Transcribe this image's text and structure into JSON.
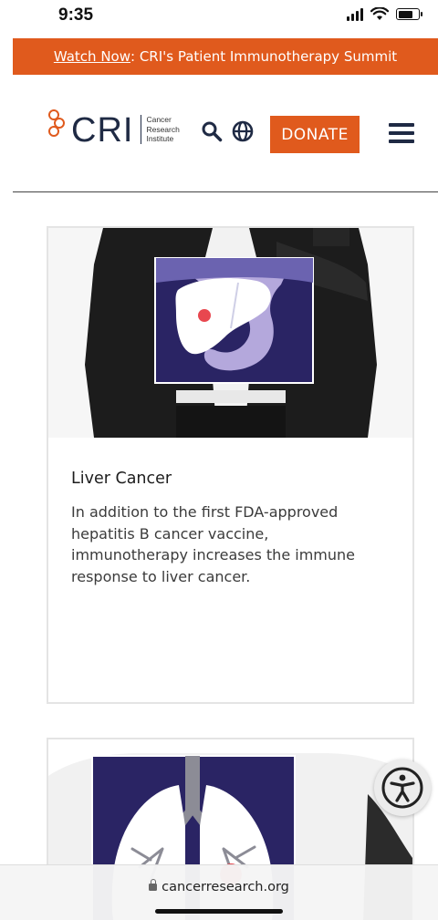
{
  "status_bar": {
    "time": "9:35"
  },
  "banner": {
    "link_text": "Watch Now",
    "rest_text": ": CRI's Patient Immunotherapy Summit"
  },
  "header": {
    "logo_text": "CRI",
    "logo_sub_1": "Cancer",
    "logo_sub_2": "Research",
    "logo_sub_3": "Institute",
    "donate_label": "DONATE"
  },
  "cards": [
    {
      "title": "Liver Cancer",
      "description": "In addition to the first FDA-approved hepatitis B cancer vaccine, immunotherapy increases the immune response to liver cancer."
    }
  ],
  "browser": {
    "url": "cancerresearch.org"
  },
  "colors": {
    "brand_orange": "#e05a1d",
    "navy": "#1f2a44",
    "illustration_bg": "#2a2464",
    "organ_light": "#b4a8dc",
    "tumor": "#e8474f"
  },
  "icons": [
    "search-icon",
    "globe-icon",
    "menu-icon",
    "accessibility-icon",
    "lock-icon"
  ]
}
